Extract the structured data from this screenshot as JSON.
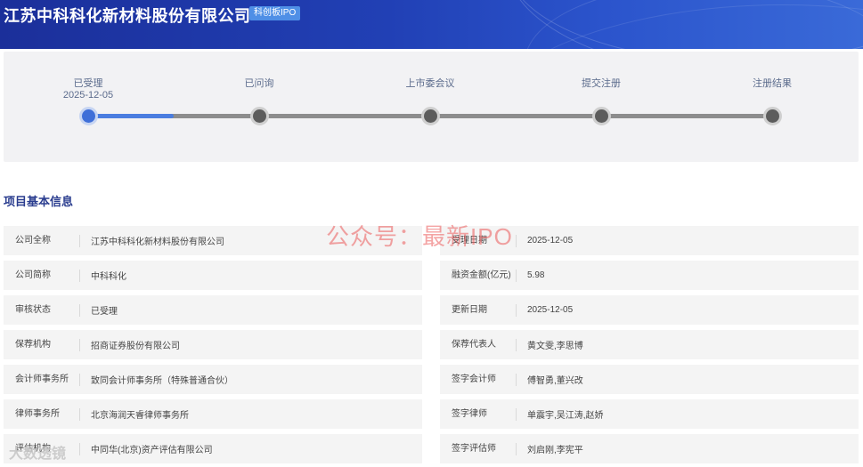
{
  "header": {
    "company_name": "江苏中科科化新材料股份有限公司",
    "board_badge": "科创板IPO"
  },
  "progress": {
    "steps": [
      {
        "label": "已受理",
        "date": "2025-12-05",
        "active": true
      },
      {
        "label": "已问询",
        "date": "",
        "active": false
      },
      {
        "label": "上市委会议",
        "date": "",
        "active": false
      },
      {
        "label": "提交注册",
        "date": "",
        "active": false
      },
      {
        "label": "注册结果",
        "date": "",
        "active": false
      }
    ],
    "completed_fraction": 0.125
  },
  "section": {
    "title": "项目基本信息"
  },
  "info": {
    "left": [
      {
        "label": "公司全称",
        "value": "江苏中科科化新材料股份有限公司"
      },
      {
        "label": "公司简称",
        "value": "中科科化"
      },
      {
        "label": "审核状态",
        "value": "已受理"
      },
      {
        "label": "保荐机构",
        "value": "招商证券股份有限公司"
      },
      {
        "label": "会计师事务所",
        "value": "致同会计师事务所（特殊普通合伙）"
      },
      {
        "label": "律师事务所",
        "value": "北京海润天睿律师事务所"
      },
      {
        "label": "评估机构",
        "value": "中同华(北京)资产评估有限公司"
      }
    ],
    "right": [
      {
        "label": "受理日期",
        "value": "2025-12-05"
      },
      {
        "label": "融资金额(亿元)",
        "value": "5.98"
      },
      {
        "label": "更新日期",
        "value": "2025-12-05"
      },
      {
        "label": "保荐代表人",
        "value": "黄文雯,李思博"
      },
      {
        "label": "签字会计师",
        "value": "傅智勇,董兴改"
      },
      {
        "label": "签字律师",
        "value": "单震宇,吴江涛,赵娇"
      },
      {
        "label": "签字评估师",
        "value": "刘启刚,李宪平"
      }
    ]
  },
  "watermarks": {
    "center": "公众号：最新IPO",
    "corner": "大数透镜"
  }
}
